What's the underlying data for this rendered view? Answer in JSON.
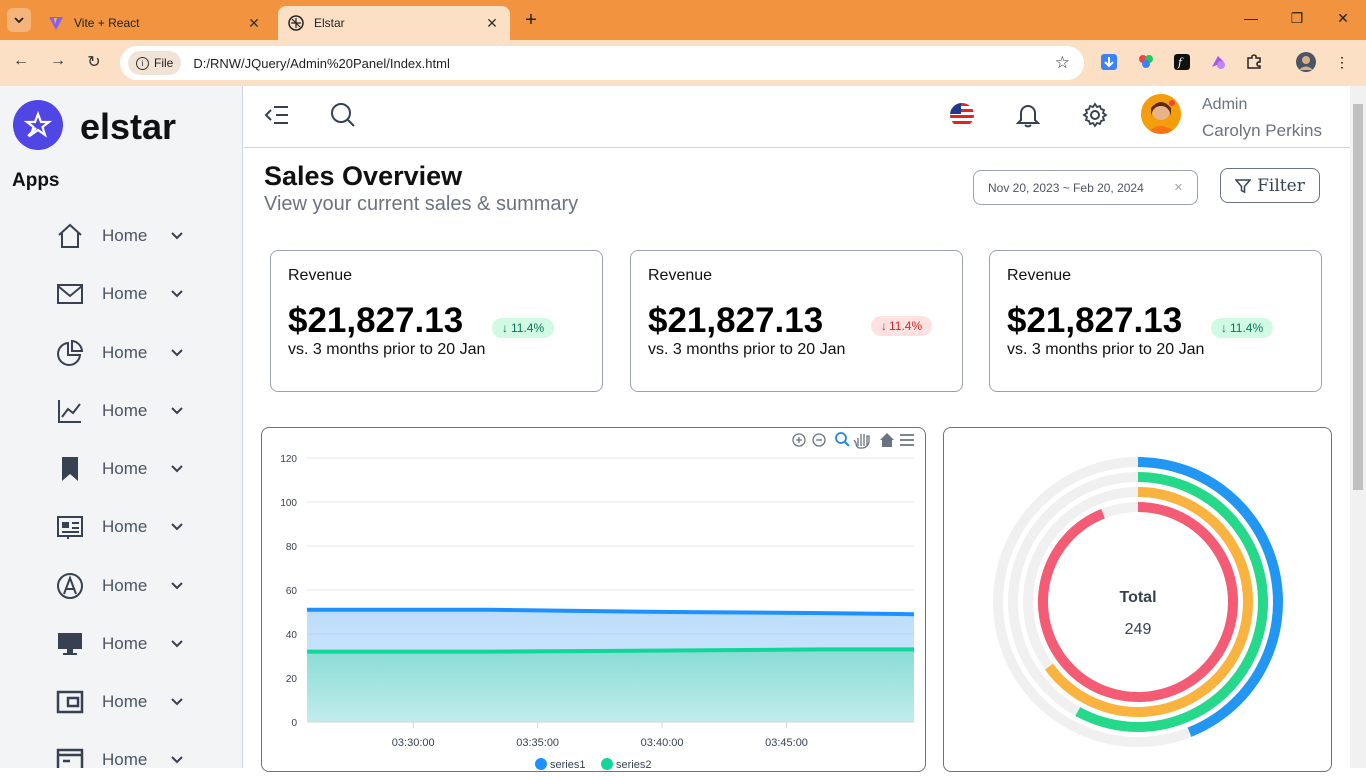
{
  "browser": {
    "tabs": [
      {
        "title": "Vite + React",
        "active": false
      },
      {
        "title": "Elstar",
        "active": true
      }
    ],
    "url_scheme": "File",
    "url": "D:/RNW/JQuery/Admin%20Panel/Index.html"
  },
  "sidebar": {
    "brand": "elstar",
    "section": "Apps",
    "items": [
      {
        "label": "Home",
        "icon": "home-icon"
      },
      {
        "label": "Home",
        "icon": "mail-icon"
      },
      {
        "label": "Home",
        "icon": "pie-chart-icon"
      },
      {
        "label": "Home",
        "icon": "line-chart-icon"
      },
      {
        "label": "Home",
        "icon": "bookmark-icon"
      },
      {
        "label": "Home",
        "icon": "id-card-icon"
      },
      {
        "label": "Home",
        "icon": "compass-icon"
      },
      {
        "label": "Home",
        "icon": "monitor-icon"
      },
      {
        "label": "Home",
        "icon": "wallet-icon"
      },
      {
        "label": "Home",
        "icon": "window-icon"
      }
    ]
  },
  "header": {
    "user_role": "Admin",
    "user_name": "Carolyn Perkins"
  },
  "main": {
    "title": "Sales Overview",
    "subtitle": "View your current sales & summary",
    "date_range": "Nov 20, 2023 ~ Feb 20, 2024",
    "clear_label": "X",
    "filter_label": "Filter",
    "cards": [
      {
        "title": "Revenue",
        "value": "$21,827.13",
        "compare": "vs. 3 months prior to 20 Jan",
        "change": "11.4%",
        "direction": "up"
      },
      {
        "title": "Revenue",
        "value": "$21,827.13",
        "compare": "vs. 3 months prior to 20 Jan",
        "change": "11.4%",
        "direction": "down"
      },
      {
        "title": "Revenue",
        "value": "$21,827.13",
        "compare": "vs. 3 months prior to 20 Jan",
        "change": "11.4%",
        "direction": "up"
      }
    ],
    "donut": {
      "label": "Total",
      "value": "249"
    }
  },
  "colors": {
    "series1": "#1e90ff",
    "series2": "#10d69a",
    "ring_blue": "#2196f3",
    "ring_green": "#26d98a",
    "ring_yellow": "#fbb340",
    "ring_red": "#f45b74"
  },
  "chart_data": [
    {
      "type": "area",
      "x": [
        "03:30:00",
        "03:35:00",
        "03:40:00",
        "03:45:00"
      ],
      "series": [
        {
          "name": "series1",
          "points": [
            [
              0,
              51
            ],
            [
              0.3,
              51
            ],
            [
              0.6,
              50
            ],
            [
              0.85,
              49.5
            ],
            [
              1,
              49
            ]
          ]
        },
        {
          "name": "series2",
          "points": [
            [
              0,
              32
            ],
            [
              0.3,
              32
            ],
            [
              0.6,
              32.5
            ],
            [
              0.85,
              33
            ],
            [
              1,
              33
            ]
          ]
        }
      ],
      "ylim": [
        0,
        120
      ],
      "yticks": [
        0,
        20,
        40,
        60,
        80,
        100,
        120
      ],
      "grid": true,
      "legend": "bottom"
    },
    {
      "type": "radialBar",
      "label": "Total",
      "total": 249,
      "series": [
        {
          "color": "ring_blue",
          "value": 44
        },
        {
          "color": "ring_green",
          "value": 58
        },
        {
          "color": "ring_yellow",
          "value": 65
        },
        {
          "color": "ring_red",
          "value": 94
        }
      ]
    }
  ]
}
